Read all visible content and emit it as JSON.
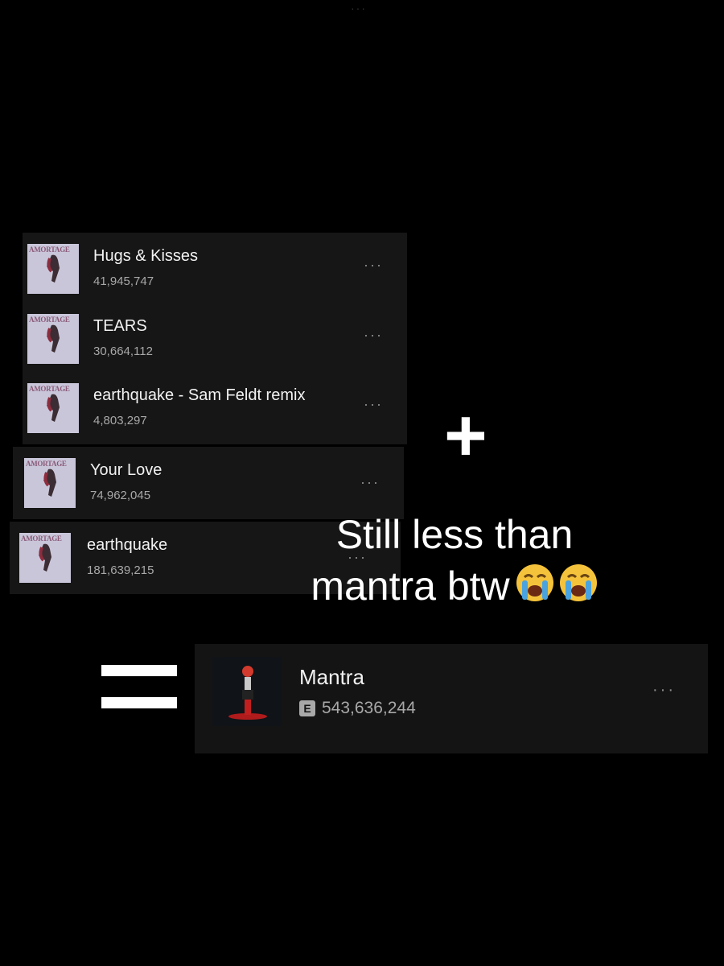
{
  "tracks": [
    {
      "title": "Hugs & Kisses",
      "plays": "41,945,747",
      "cover_label": "AMORTAGE"
    },
    {
      "title": "TEARS",
      "plays": "30,664,112",
      "cover_label": "AMORTAGE"
    },
    {
      "title": "earthquake - Sam Feldt remix",
      "plays": "4,803,297",
      "cover_label": "AMORTAGE"
    },
    {
      "title": "Your Love",
      "plays": "74,962,045",
      "cover_label": "AMORTAGE"
    },
    {
      "title": "earthquake",
      "plays": "181,639,215",
      "cover_label": "AMORTAGE"
    }
  ],
  "operators": {
    "plus": "+"
  },
  "caption": {
    "line1": "Still less than",
    "line2": "mantra btw"
  },
  "result": {
    "title": "Mantra",
    "plays": "543,636,244",
    "explicit_badge": "E"
  },
  "more_label": "···",
  "colors": {
    "background": "#000000",
    "row": "#161616",
    "secondary_text": "#a8a8a8"
  }
}
